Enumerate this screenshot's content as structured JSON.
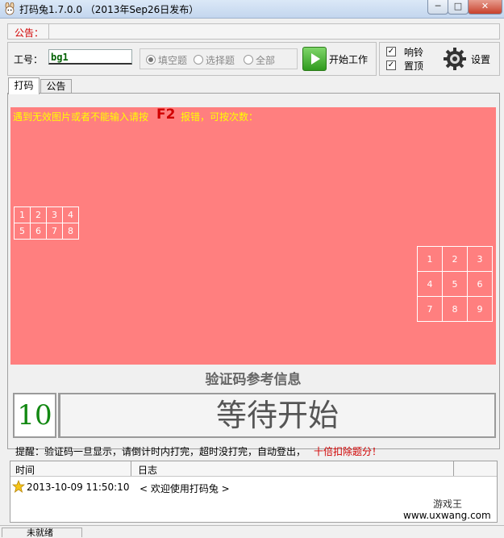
{
  "window": {
    "title": "打码兔1.7.0.0 （2013年Sep26日发布）",
    "minimize": "─",
    "maximize": "□",
    "close": "✕"
  },
  "notice_bar": {
    "label": "公告：",
    "text": ""
  },
  "worker": {
    "label": "工号：",
    "value": "bg1"
  },
  "mode": {
    "options": [
      "填空题",
      "选择题",
      "全部"
    ],
    "selected": "填空题"
  },
  "start_button": {
    "label": "开始工作"
  },
  "options": {
    "ring": {
      "label": "响铃",
      "checked": true
    },
    "ontop": {
      "label": "置顶",
      "checked": true
    },
    "settings_label": "设置"
  },
  "tabs": [
    "打码",
    "公告"
  ],
  "captcha": {
    "hint_before": "遇到无效图片或者不能输入请按",
    "hint_key": "F2",
    "hint_after": "报错，可按次数：",
    "small_grid": [
      [
        "1",
        "2",
        "3",
        "4"
      ],
      [
        "5",
        "6",
        "7",
        "8"
      ]
    ],
    "big_grid": [
      [
        "1",
        "2",
        "3"
      ],
      [
        "4",
        "5",
        "6"
      ],
      [
        "7",
        "8",
        "9"
      ]
    ],
    "bg_color": "#ff7f7f"
  },
  "reference_title": "验证码参考信息",
  "countdown": "10",
  "status_text": "等待开始",
  "reminder": {
    "text": "提醒：验证码一旦显示，请倒计时内打完，超时没打完，自动登出，",
    "warning": "十倍扣除题分！"
  },
  "log": {
    "columns": [
      "时间",
      "日志"
    ],
    "rows": [
      {
        "icon": "star-icon",
        "time": "2013-10-09 11:50:10",
        "message": "< 欢迎使用打码兔 >"
      }
    ]
  },
  "watermark": {
    "line1": "游戏王",
    "line2": "www.uxwang.com"
  },
  "statusbar": {
    "text": "未就绪"
  }
}
